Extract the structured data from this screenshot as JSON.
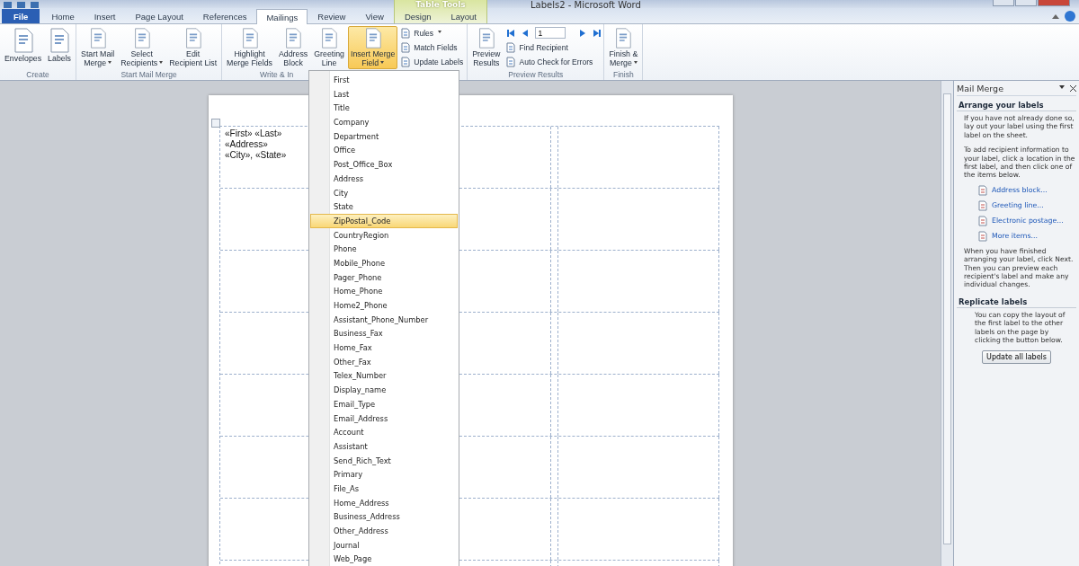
{
  "window": {
    "title": "Labels2  -  Microsoft Word"
  },
  "contextual_tab_group": "Table Tools",
  "tabs": [
    {
      "label": "File",
      "kind": "file",
      "selected": false
    },
    {
      "label": "Home",
      "kind": "tab",
      "selected": false
    },
    {
      "label": "Insert",
      "kind": "tab",
      "selected": false
    },
    {
      "label": "Page Layout",
      "kind": "tab",
      "selected": false
    },
    {
      "label": "References",
      "kind": "tab",
      "selected": false
    },
    {
      "label": "Mailings",
      "kind": "tab",
      "selected": true
    },
    {
      "label": "Review",
      "kind": "tab",
      "selected": false
    },
    {
      "label": "View",
      "kind": "tab",
      "selected": false
    },
    {
      "label": "Design",
      "kind": "context",
      "selected": false
    },
    {
      "label": "Layout",
      "kind": "context",
      "selected": false
    }
  ],
  "ribbon_groups": [
    {
      "label": "Create",
      "items": [
        {
          "kind": "large",
          "lines": [
            "Envelopes"
          ],
          "dropdown": false,
          "selected": false
        },
        {
          "kind": "large",
          "lines": [
            "Labels"
          ],
          "dropdown": false,
          "selected": false
        }
      ]
    },
    {
      "label": "Start Mail Merge",
      "items": [
        {
          "kind": "large",
          "lines": [
            "Start Mail",
            "Merge"
          ],
          "dropdown": true,
          "selected": false
        },
        {
          "kind": "large",
          "lines": [
            "Select",
            "Recipients"
          ],
          "dropdown": true,
          "selected": false
        },
        {
          "kind": "large",
          "lines": [
            "Edit",
            "Recipient List"
          ],
          "dropdown": false,
          "selected": false
        }
      ]
    },
    {
      "label": "Write & In",
      "items": [
        {
          "kind": "large",
          "lines": [
            "Highlight",
            "Merge Fields"
          ],
          "dropdown": false,
          "selected": false
        },
        {
          "kind": "large",
          "lines": [
            "Address",
            "Block"
          ],
          "dropdown": false,
          "selected": false
        },
        {
          "kind": "large",
          "lines": [
            "Greeting",
            "Line"
          ],
          "dropdown": false,
          "selected": false
        },
        {
          "kind": "large",
          "lines": [
            "Insert Merge",
            "Field"
          ],
          "dropdown": true,
          "selected": true
        },
        {
          "kind": "stack",
          "entries": [
            {
              "label": "Rules",
              "dropdown": true
            },
            {
              "label": "Match Fields",
              "dropdown": false
            },
            {
              "label": "Update Labels",
              "dropdown": false
            }
          ]
        }
      ]
    },
    {
      "label": "Preview Results",
      "items": [
        {
          "kind": "large",
          "lines": [
            "Preview",
            "Results"
          ],
          "dropdown": false,
          "selected": false
        },
        {
          "kind": "nav",
          "record": "1",
          "entries": [
            {
              "label": "Find Recipient",
              "dropdown": false
            },
            {
              "label": "Auto Check for Errors",
              "dropdown": false
            }
          ]
        }
      ]
    },
    {
      "label": "Finish",
      "items": [
        {
          "kind": "large",
          "lines": [
            "Finish &",
            "Merge"
          ],
          "dropdown": true,
          "selected": false
        }
      ]
    }
  ],
  "document": {
    "label_lines": [
      "«First» «Last»",
      "«Address»",
      "«City», «State»"
    ]
  },
  "merge_field_menu": [
    {
      "label": "First",
      "selected": false
    },
    {
      "label": "Last",
      "selected": false
    },
    {
      "label": "Title",
      "selected": false
    },
    {
      "label": "Company",
      "selected": false
    },
    {
      "label": "Department",
      "selected": false
    },
    {
      "label": "Office",
      "selected": false
    },
    {
      "label": "Post_Office_Box",
      "selected": false
    },
    {
      "label": "Address",
      "selected": false
    },
    {
      "label": "City",
      "selected": false
    },
    {
      "label": "State",
      "selected": false
    },
    {
      "label": "ZipPostal_Code",
      "selected": true
    },
    {
      "label": "CountryRegion",
      "selected": false
    },
    {
      "label": "Phone",
      "selected": false
    },
    {
      "label": "Mobile_Phone",
      "selected": false
    },
    {
      "label": "Pager_Phone",
      "selected": false
    },
    {
      "label": "Home_Phone",
      "selected": false
    },
    {
      "label": "Home2_Phone",
      "selected": false
    },
    {
      "label": "Assistant_Phone_Number",
      "selected": false
    },
    {
      "label": "Business_Fax",
      "selected": false
    },
    {
      "label": "Home_Fax",
      "selected": false
    },
    {
      "label": "Other_Fax",
      "selected": false
    },
    {
      "label": "Telex_Number",
      "selected": false
    },
    {
      "label": "Display_name",
      "selected": false
    },
    {
      "label": "Email_Type",
      "selected": false
    },
    {
      "label": "Email_Address",
      "selected": false
    },
    {
      "label": "Account",
      "selected": false
    },
    {
      "label": "Assistant",
      "selected": false
    },
    {
      "label": "Send_Rich_Text",
      "selected": false
    },
    {
      "label": "Primary",
      "selected": false
    },
    {
      "label": "File_As",
      "selected": false
    },
    {
      "label": "Home_Address",
      "selected": false
    },
    {
      "label": "Business_Address",
      "selected": false
    },
    {
      "label": "Other_Address",
      "selected": false
    },
    {
      "label": "Journal",
      "selected": false
    },
    {
      "label": "Web_Page",
      "selected": false
    }
  ],
  "task_pane": {
    "title": "Mail Merge",
    "sections": [
      {
        "heading": "Arrange your labels",
        "blocks": [
          {
            "kind": "text",
            "text": "If you have not already done so, lay out your label using the first label on the sheet."
          },
          {
            "kind": "text",
            "text": "To add recipient information to your label, click a location in the first label, and then click one of the items below."
          },
          {
            "kind": "link",
            "text": "Address block..."
          },
          {
            "kind": "link",
            "text": "Greeting line..."
          },
          {
            "kind": "link",
            "text": "Electronic postage..."
          },
          {
            "kind": "link",
            "text": "More items..."
          },
          {
            "kind": "text",
            "text": "When you have finished arranging your label, click Next. Then you can preview each recipient's label and make any individual changes."
          }
        ]
      },
      {
        "heading": "Replicate labels",
        "blocks": [
          {
            "kind": "indented",
            "text": "You can copy the layout of the first label to the other labels on the page by clicking the button below."
          },
          {
            "kind": "button",
            "text": "Update all labels"
          }
        ]
      }
    ]
  }
}
